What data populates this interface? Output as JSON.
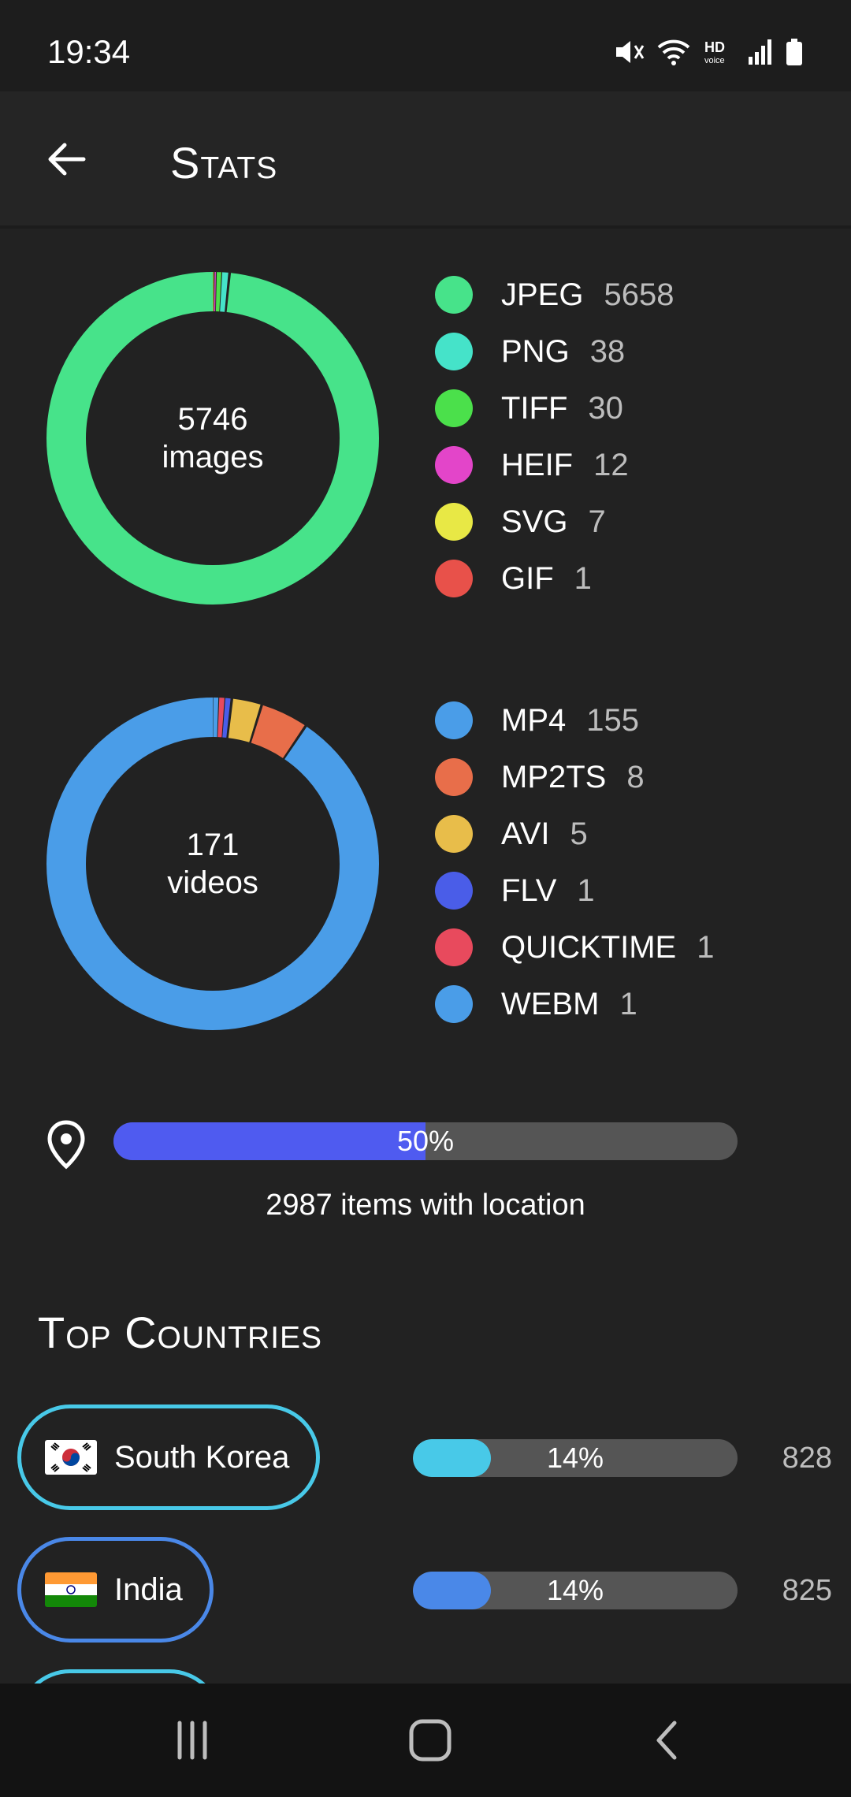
{
  "status_bar": {
    "time": "19:34",
    "icons": [
      "mute-icon",
      "wifi-icon",
      "hd-voice-icon",
      "signal-icon",
      "battery-icon"
    ]
  },
  "app_bar": {
    "title": "Stats",
    "back_icon": "arrow-back-icon"
  },
  "images": {
    "total": "5746",
    "unit": "images",
    "legend": [
      {
        "name": "JPEG",
        "count": "5658",
        "value": 5658,
        "color": "#47e38a"
      },
      {
        "name": "PNG",
        "count": "38",
        "value": 38,
        "color": "#45e3c9"
      },
      {
        "name": "TIFF",
        "count": "30",
        "value": 30,
        "color": "#4be04b"
      },
      {
        "name": "HEIF",
        "count": "12",
        "value": 12,
        "color": "#e345c9"
      },
      {
        "name": "SVG",
        "count": "7",
        "value": 7,
        "color": "#e8e845"
      },
      {
        "name": "GIF",
        "count": "1",
        "value": 1,
        "color": "#e8514a"
      }
    ]
  },
  "videos": {
    "total": "171",
    "unit": "videos",
    "legend": [
      {
        "name": "MP4",
        "count": "155",
        "value": 155,
        "color": "#4a9de8"
      },
      {
        "name": "MP2TS",
        "count": "8",
        "value": 8,
        "color": "#e86e4a"
      },
      {
        "name": "AVI",
        "count": "5",
        "value": 5,
        "color": "#e8bd4a"
      },
      {
        "name": "FLV",
        "count": "1",
        "value": 1,
        "color": "#4a5de8"
      },
      {
        "name": "QUICKTIME",
        "count": "1",
        "value": 1,
        "color": "#e84a5d"
      },
      {
        "name": "WEBM",
        "count": "1",
        "value": 1,
        "color": "#4a9de8"
      }
    ]
  },
  "location": {
    "percent_label": "50%",
    "fraction": 0.5,
    "caption": "2987 items with location",
    "icon": "location-pin-icon",
    "color": "#4f5bf0"
  },
  "top_countries": {
    "title": "Top Countries",
    "items": [
      {
        "name": "South Korea",
        "flag": "south-korea-flag-icon",
        "percent_label": "14%",
        "fraction": 0.24,
        "count": "828",
        "color": "#48c9e8"
      },
      {
        "name": "India",
        "flag": "india-flag-icon",
        "percent_label": "14%",
        "fraction": 0.24,
        "count": "825",
        "color": "#4a88e8"
      }
    ]
  },
  "nav_bar": {
    "icons": [
      "recent-apps-icon",
      "home-icon",
      "back-icon"
    ]
  }
}
